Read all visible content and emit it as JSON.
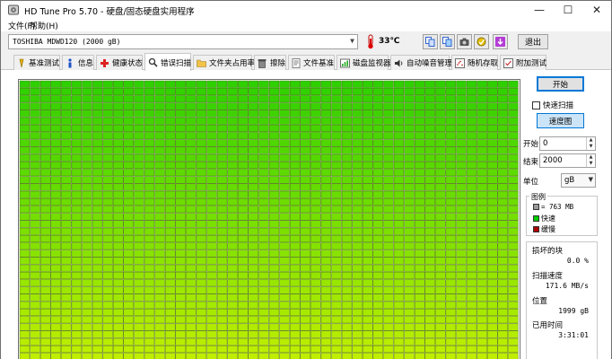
{
  "window": {
    "title": "HD Tune Pro 5.70 - 硬盘/固态硬盘实用程序",
    "minimize_glyph": "—",
    "maximize_glyph": "☐",
    "close_glyph": "✕"
  },
  "menu": [
    "文件(F)",
    "帮助(H)"
  ],
  "toolbar": {
    "drive": "TOSHIBA MDWD120 (2000 gB)",
    "temperature": "33℃",
    "exit_label": "退出",
    "icons": [
      "copy-text-icon",
      "copy-image-icon",
      "camera-icon",
      "health-icon",
      "download-icon"
    ]
  },
  "tabs": [
    {
      "label": "基准测试",
      "icon": "benchmark-icon"
    },
    {
      "label": "信息",
      "icon": "info-icon"
    },
    {
      "label": "健康状态",
      "icon": "health-cross-icon"
    },
    {
      "label": "错误扫描",
      "icon": "search-icon",
      "active": true
    },
    {
      "label": "文件夹占用率",
      "icon": "folder-icon"
    },
    {
      "label": "擦除",
      "icon": "trash-icon"
    },
    {
      "label": "文件基准",
      "icon": "file-benchmark-icon"
    },
    {
      "label": "磁盘监视器",
      "icon": "monitor-icon"
    },
    {
      "label": "自动噪音管理",
      "icon": "speaker-icon"
    },
    {
      "label": "随机存取",
      "icon": "random-icon"
    },
    {
      "label": "附加测试",
      "icon": "extra-test-icon"
    }
  ],
  "controls": {
    "start_button": "开始",
    "quick_scan_label": "快速扫描",
    "quick_scan_checked": false,
    "speed_map_button": "速度图",
    "start_label": "开始",
    "start_value": "0",
    "end_label": "结束",
    "end_value": "2000",
    "unit_label": "单位",
    "unit_value": "gB"
  },
  "legend": {
    "title": "图例",
    "block_size": "= 763 MB",
    "ok": "快速",
    "ok_color": "#00cc00",
    "slow": "缓慢",
    "slow_color": "#aa0000",
    "block_color": "#999999"
  },
  "stats": {
    "damaged_label": "损坏的块",
    "damaged_value": "0.0 %",
    "scan_speed_label": "扫描速度",
    "scan_speed_value": "171.6 MB/s",
    "position_label": "位置",
    "position_value": "1999 gB",
    "elapsed_label": "已用时间",
    "elapsed_value": "3:31:01"
  },
  "scan_grid": {
    "columns": 48,
    "visible_rows": 40,
    "top_color": "#2ed000",
    "bottom_color": "#c8f000",
    "line_color": "#3a5a00"
  }
}
